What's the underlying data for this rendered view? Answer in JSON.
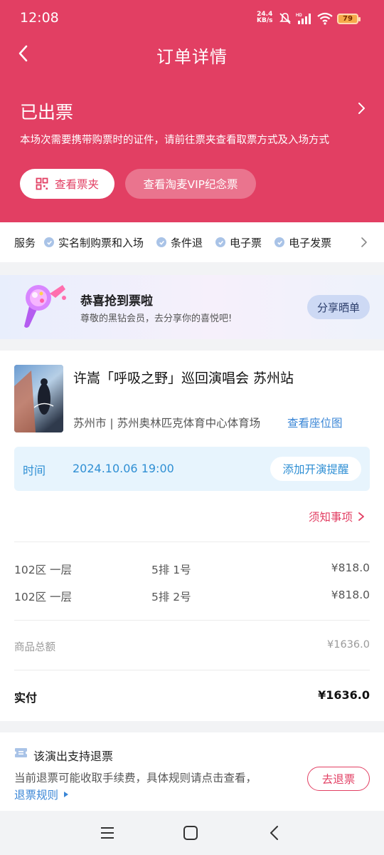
{
  "status_bar": {
    "time": "12:08",
    "net_speed_value": "24.4",
    "net_speed_unit": "KB/s",
    "battery": "79"
  },
  "nav": {
    "title": "订单详情"
  },
  "order": {
    "status": "已出票",
    "description": "本场次需要携带购票时的证件，请前往票夹查看取票方式及入场方式",
    "wallet_button": "查看票夹",
    "vip_button": "查看淘麦VIP纪念票"
  },
  "services": {
    "title": "服务",
    "items": [
      "实名制购票和入场",
      "条件退",
      "电子票",
      "电子发票"
    ]
  },
  "promo": {
    "title": "恭喜抢到票啦",
    "subtitle": "尊敬的黑钻会员，去分享你的喜悦吧!",
    "share_button": "分享晒单"
  },
  "show": {
    "title": "许嵩「呼吸之野」巡回演唱会 苏州站",
    "venue": "苏州市 | 苏州奥林匹克体育中心体育场",
    "seatmap_link": "查看座位图",
    "time_label": "时间",
    "time_value": "2024.10.06 19:00",
    "remind_button": "添加开演提醒",
    "notice_link": "须知事项"
  },
  "tickets": [
    {
      "area": "102区 一层",
      "seat": "5排 1号",
      "price": "¥818.0"
    },
    {
      "area": "102区 一层",
      "seat": "5排 2号",
      "price": "¥818.0"
    }
  ],
  "totals": {
    "subtotal_label": "商品总额",
    "subtotal_value": "¥1636.0",
    "paid_label": "实付",
    "paid_value": "¥1636.0"
  },
  "refund": {
    "title": "该演出支持退票",
    "description": "当前退票可能收取手续费，具体规则请点击查看，",
    "rule_link": "退票规则",
    "refund_button": "去退票"
  },
  "colors": {
    "brand": "#e23f63",
    "link": "#3a86d6",
    "time_text": "#2f8fd4"
  }
}
